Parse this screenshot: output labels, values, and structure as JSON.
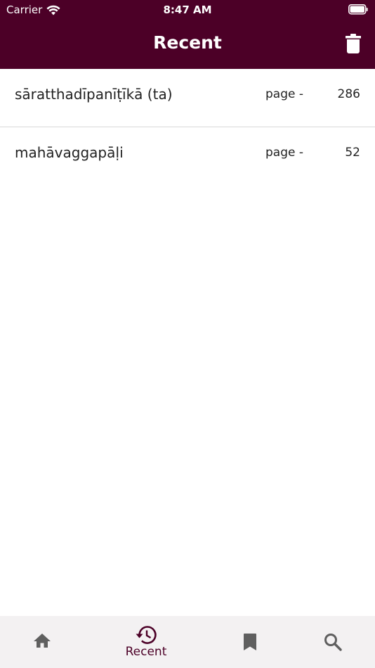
{
  "status_bar": {
    "carrier": "Carrier",
    "time": "8:47 AM",
    "wifi_icon": "wifi-icon",
    "battery_icon": "battery-icon"
  },
  "app_bar": {
    "title": "Recent",
    "background": "#4c0027",
    "delete_icon": "trash-icon"
  },
  "recent_items": [
    {
      "title": "sāratthadīpanīṭīkā (ta)",
      "page_label": "page -",
      "page": "286"
    },
    {
      "title": "mahāvaggapāḷi",
      "page_label": "page -",
      "page": "52"
    }
  ],
  "bottom_nav": {
    "background": "#f3f1f2",
    "active_color": "#4c0027",
    "inactive_color": "#5f5f5f",
    "items": [
      {
        "icon": "home-icon",
        "label": ""
      },
      {
        "icon": "history-icon",
        "label": "Recent",
        "active": true
      },
      {
        "icon": "bookmark-icon",
        "label": ""
      },
      {
        "icon": "search-icon",
        "label": ""
      }
    ]
  }
}
